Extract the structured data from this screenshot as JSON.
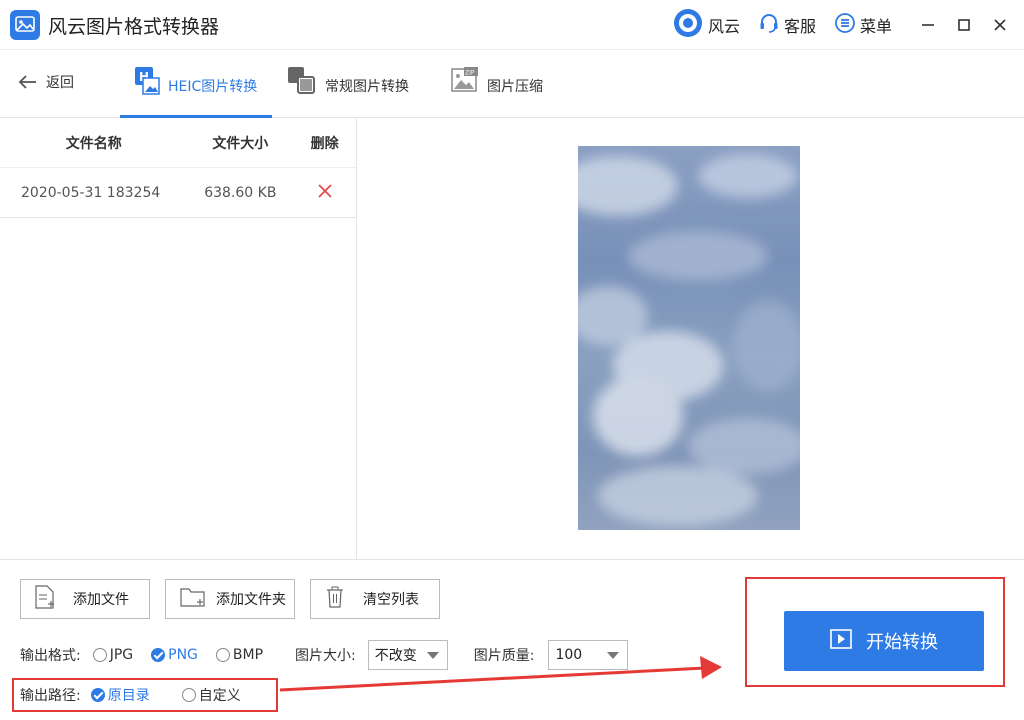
{
  "app": {
    "title": "风云图片格式转换器"
  },
  "titlebar": {
    "brand_label": "风云",
    "service_label": "客服",
    "menu_label": "菜单"
  },
  "nav": {
    "back_label": "返回",
    "tabs": [
      {
        "label": "HEIC图片转换",
        "active": true
      },
      {
        "label": "常规图片转换",
        "active": false
      },
      {
        "label": "图片压缩",
        "active": false
      }
    ]
  },
  "file_list": {
    "headers": {
      "name": "文件名称",
      "size": "文件大小",
      "delete": "删除"
    },
    "rows": [
      {
        "name": "2020-05-31 183254",
        "size": "638.60 KB"
      }
    ]
  },
  "actions": {
    "add_file": "添加文件",
    "add_folder": "添加文件夹",
    "clear_list": "清空列表"
  },
  "options": {
    "format_label": "输出格式:",
    "formats": [
      "JPG",
      "PNG",
      "BMP"
    ],
    "selected_format": "PNG",
    "size_label": "图片大小:",
    "size_value": "不改变",
    "quality_label": "图片质量:",
    "quality_value": "100",
    "path_label": "输出路径:",
    "path_options": [
      "原目录",
      "自定义"
    ],
    "selected_path": "原目录"
  },
  "start": {
    "label": "开始转换"
  },
  "colors": {
    "accent": "#2f7be5",
    "highlight": "#e53935"
  }
}
